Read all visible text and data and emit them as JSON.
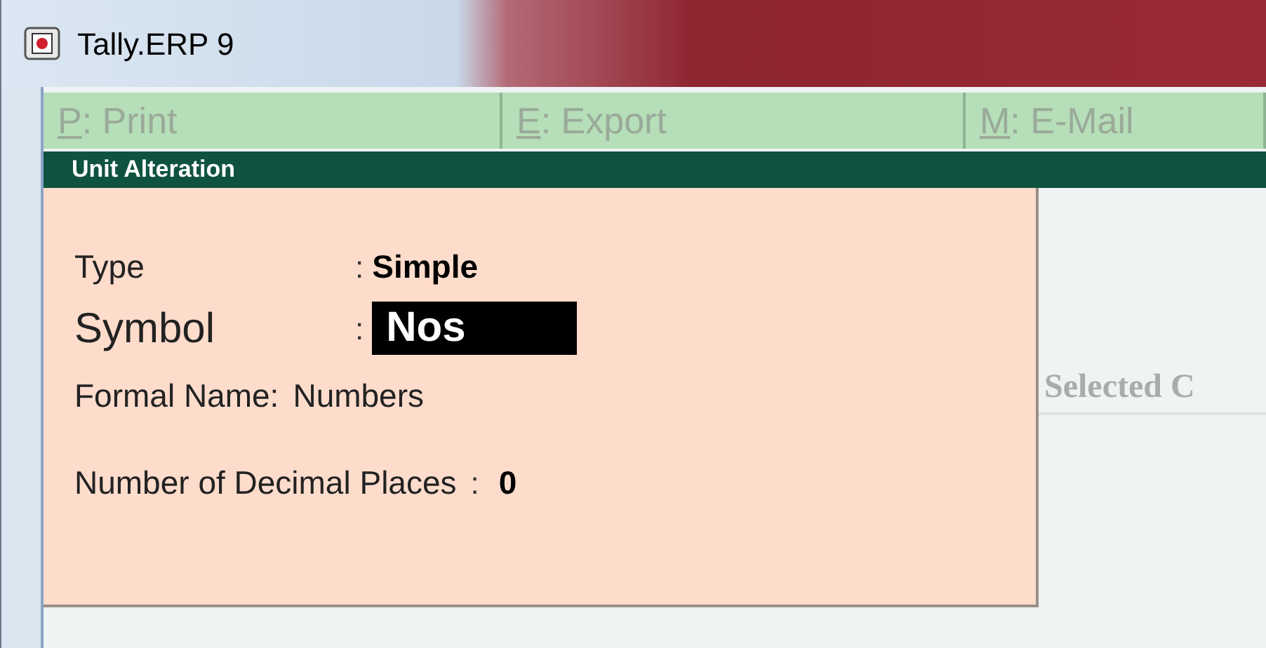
{
  "window": {
    "title": "Tally.ERP 9"
  },
  "buttons": [
    {
      "key": "P",
      "label": ": Print"
    },
    {
      "key": "E",
      "label": ": Export"
    },
    {
      "key": "M",
      "label": ": E-Mail"
    }
  ],
  "screen_title": "Unit Alteration",
  "fields": [
    {
      "label": "Type",
      "separator": ":",
      "value": "Simple",
      "focused": false
    },
    {
      "label": "Symbol",
      "separator": ":",
      "value": "Nos",
      "focused": true
    },
    {
      "label": "Formal Name:",
      "value": "Numbers",
      "focused": false
    },
    {
      "label": "Number of Decimal Places",
      "separator": ":",
      "value": "0",
      "focused": false
    }
  ],
  "background_text": "Selected C"
}
